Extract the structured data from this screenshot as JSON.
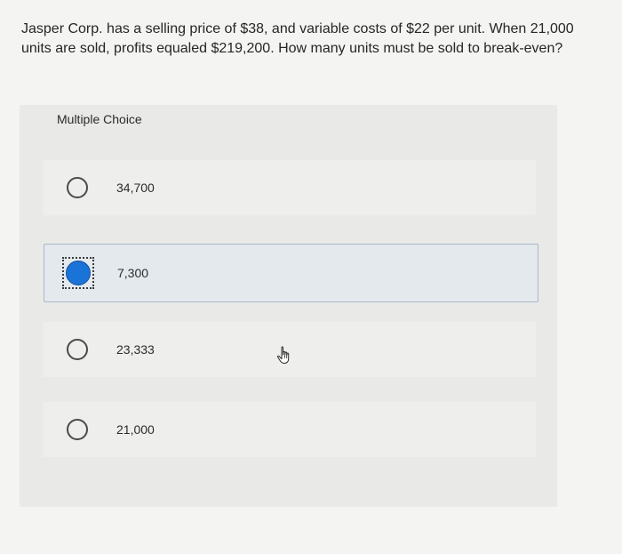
{
  "question": {
    "text": "Jasper Corp. has a selling price of $38, and variable costs of $22 per unit. When 21,000 units are sold, profits equaled $219,200. How many units must be sold to break-even?"
  },
  "panel": {
    "title": "Multiple Choice"
  },
  "choices": [
    {
      "label": "34,700",
      "selected": false
    },
    {
      "label": "7,300",
      "selected": true
    },
    {
      "label": "23,333",
      "selected": false
    },
    {
      "label": "21,000",
      "selected": false
    }
  ],
  "colors": {
    "accent": "#1a73d6",
    "selected_bg": "#e4e9ee",
    "selected_border": "#a9b9c6"
  },
  "icons": {
    "cursor": "hand-pointer-icon"
  }
}
